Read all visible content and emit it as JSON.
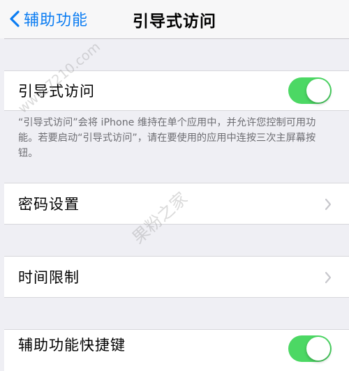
{
  "nav": {
    "back_label": "辅助功能",
    "title": "引导式访问"
  },
  "guided_access": {
    "label": "引导式访问",
    "enabled": true,
    "description": "“引导式访问”会将 iPhone 维持在单个应用中，并允许您控制可用功能。若要启动“引导式访问”，请在要使用的应用中连按三次主屏幕按钮。"
  },
  "passcode_settings": {
    "label": "密码设置"
  },
  "time_limits": {
    "label": "时间限制"
  },
  "accessibility_shortcut": {
    "label": "辅助功能快捷键",
    "enabled": true
  },
  "watermarks": {
    "url": "www.7210.com",
    "brand": "果粉之家"
  },
  "colors": {
    "tint": "#0a7cf2",
    "toggle_on": "#4cd864",
    "background": "#efeff4",
    "footer_text": "#6d6d72",
    "chevron": "#c7c7cc"
  },
  "icons": {
    "back": "chevron-left-icon",
    "disclosure": "chevron-right-icon"
  }
}
